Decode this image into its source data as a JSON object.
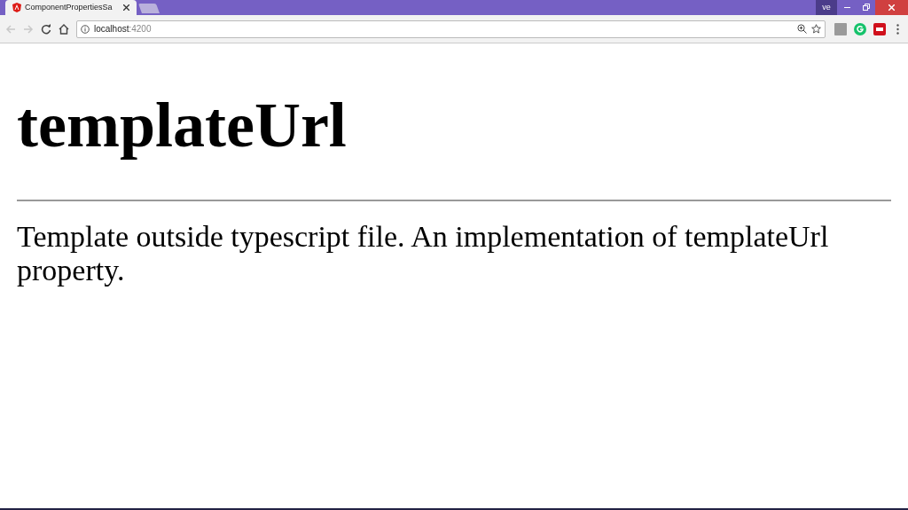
{
  "browser": {
    "tabs": [
      {
        "title": "ComponentPropertiesSa",
        "selected": true
      }
    ],
    "profile": "ve",
    "address": {
      "host": "localhost",
      "port": ":4200"
    }
  },
  "page": {
    "heading": "templateUrl",
    "paragraph": "Template outside typescript file. An implementation of templateUrl property."
  }
}
